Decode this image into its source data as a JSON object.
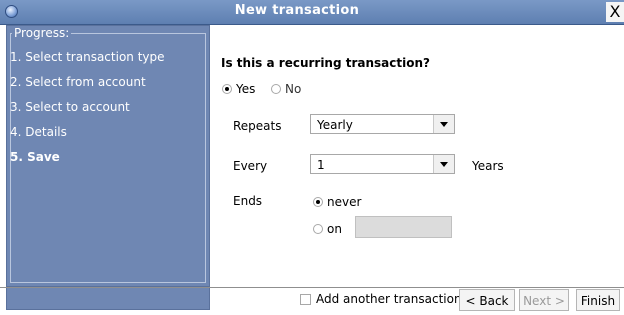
{
  "window": {
    "title": "New transaction",
    "close_glyph": "X"
  },
  "progress": {
    "title": "Progress:",
    "steps": [
      "1. Select transaction type",
      "2. Select from account",
      "3. Select to account",
      "4. Details",
      "5. Save"
    ],
    "current_step_index": 4
  },
  "recurring": {
    "question": "Is this a recurring transaction?",
    "yes_label": "Yes",
    "no_label": "No",
    "selected": "Yes"
  },
  "repeats": {
    "label": "Repeats",
    "value": "Yearly"
  },
  "every": {
    "label": "Every",
    "value": "1",
    "unit": "Years"
  },
  "ends": {
    "label": "Ends",
    "never_label": "never",
    "on_label": "on",
    "selected": "never",
    "on_date_value": ""
  },
  "footer": {
    "add_another_label": "Add another transaction",
    "add_another_checked": false,
    "back_label": "< Back",
    "next_label": "Next >",
    "finish_label": "Finish"
  },
  "colors": {
    "titlebar": "#6a8bbd",
    "sidebar": "#6f87b3",
    "sidebar_text": "#ffffff"
  },
  "icons": {
    "app": "app-icon",
    "close": "close-icon"
  }
}
